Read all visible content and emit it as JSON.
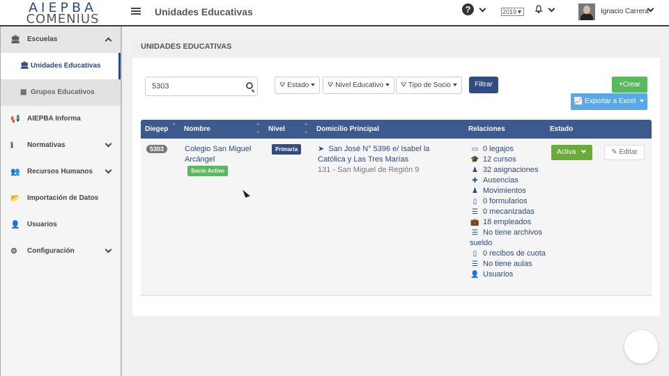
{
  "brand": {
    "line1": "AIEPBA",
    "line2": "COMENIUS"
  },
  "header": {
    "title": "Unidades Educativas",
    "year": "2019",
    "user_name": "Ignacio Carrera"
  },
  "sidebar": {
    "items": [
      {
        "label": "Escuelas",
        "icon": "institution-icon",
        "expanded": true
      },
      {
        "label": "Unidades Educativas",
        "icon": "institution-icon",
        "active": true
      },
      {
        "label": "Grupos Educativos",
        "icon": "building-icon"
      },
      {
        "label": "AIEPBA Informa",
        "icon": "megaphone-icon"
      },
      {
        "label": "Normativas",
        "icon": "info-icon"
      },
      {
        "label": "Recursos Humanos",
        "icon": "users-icon"
      },
      {
        "label": "Importación de Datos",
        "icon": "folder-icon"
      },
      {
        "label": "Usuarios",
        "icon": "user-icon"
      },
      {
        "label": "Configuración",
        "icon": "cogs-icon"
      }
    ]
  },
  "panel": {
    "title": "UNIDADES EDUCATIVAS"
  },
  "filters": {
    "search_value": "5303",
    "estado": "Estado",
    "nivel": "Nivel Educativo",
    "tipo_socio": "Tipo de Socio",
    "filtrar": "Filtrar",
    "crear": "Crear",
    "exportar": "Exportar a Excel"
  },
  "table": {
    "columns": [
      "Diegep",
      "Nombre",
      "Nivel",
      "Domicilio Principal",
      "Relaciones",
      "Estado"
    ],
    "rows": [
      {
        "diegep": "5303",
        "nombre": "Colegio San Miguel Arcángel",
        "socio": "Socio Activo",
        "nivel": "Primaria",
        "domicilio": "San José N° 5396 e/ Isabel la Católica y Las Tres Marías",
        "region": "131 - San Miguel de Región 9",
        "relaciones": [
          {
            "icon": "id-card-icon",
            "text": "0 legajos"
          },
          {
            "icon": "graduation-cap-icon",
            "text": "12 cursos"
          },
          {
            "icon": "person-icon",
            "text": "32 asignaciones"
          },
          {
            "icon": "plus-icon",
            "text": "Ausencias"
          },
          {
            "icon": "person-icon",
            "text": "Movimientos"
          },
          {
            "icon": "file-icon",
            "text": "0 formularios"
          },
          {
            "icon": "list-icon",
            "text": "0 mecanizadas"
          },
          {
            "icon": "briefcase-icon",
            "text": "18 empleados"
          },
          {
            "icon": "list-icon",
            "text": "No tiene archivos sueldo"
          },
          {
            "icon": "pdf-icon",
            "text": "0 recibos de cuota"
          },
          {
            "icon": "list-icon",
            "text": "No tiene aulas"
          },
          {
            "icon": "user-icon",
            "text": "Usuarios"
          }
        ],
        "estado": "Activa",
        "editar": "Editar"
      }
    ]
  },
  "colors": {
    "accent": "#2f4d82",
    "success": "#5cb85c",
    "info": "#5aa9e6"
  }
}
